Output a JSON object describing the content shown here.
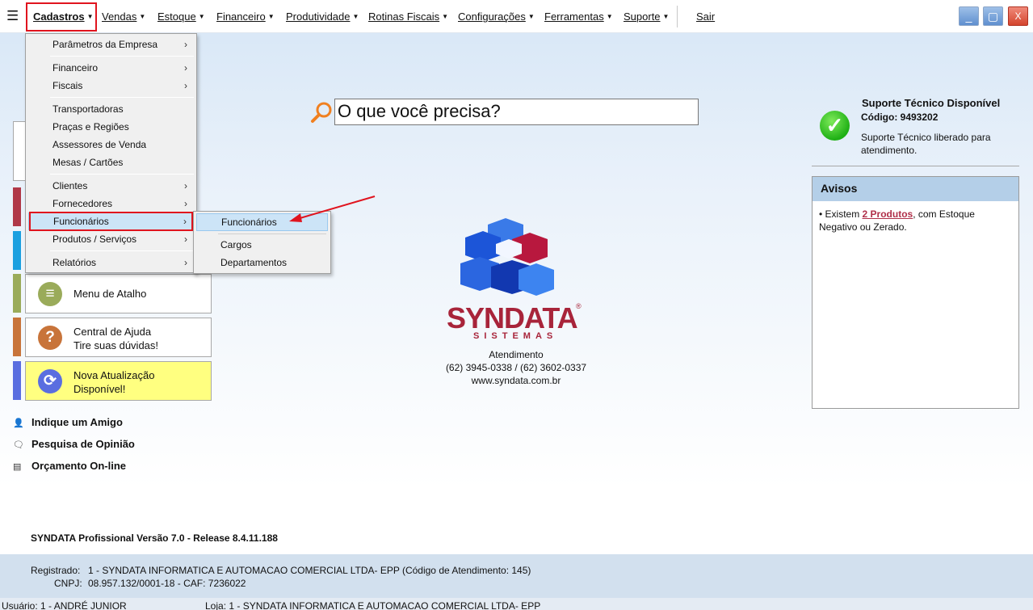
{
  "menubar": {
    "hamburger": "☰",
    "items": [
      "Cadastros",
      "Vendas",
      "Estoque",
      "Financeiro",
      "Produtividade",
      "Rotinas Fiscais",
      "Configurações",
      "Ferramentas",
      "Suporte"
    ],
    "exit": "Sair"
  },
  "window_controls": {
    "minimize": "_",
    "maximize": "▢",
    "close": "X"
  },
  "cadastros_menu": {
    "items": [
      {
        "label": "Parâmetros da Empresa",
        "submenu": true
      },
      {
        "label": "Financeiro",
        "submenu": true
      },
      {
        "label": "Fiscais",
        "submenu": true
      },
      {
        "label": "Transportadoras",
        "submenu": false
      },
      {
        "label": "Praças e Regiões",
        "submenu": false
      },
      {
        "label": "Assessores de Venda",
        "submenu": false
      },
      {
        "label": "Mesas / Cartões",
        "submenu": false
      },
      {
        "label": "Clientes",
        "submenu": true
      },
      {
        "label": "Fornecedores",
        "submenu": true
      },
      {
        "label": "Funcionários",
        "submenu": true,
        "active": true
      },
      {
        "label": "Produtos / Serviços",
        "submenu": true
      },
      {
        "label": "Relatórios",
        "submenu": true
      }
    ]
  },
  "funcionarios_submenu": {
    "items": [
      "Funcionários",
      "Cargos",
      "Departamentos"
    ]
  },
  "search": {
    "placeholder": "O que você precisa?"
  },
  "side_cards": [
    {
      "label": "Menu de Atalho",
      "color": "#9aab5a",
      "icon": "list-icon"
    },
    {
      "label_line1": "Central de Ajuda",
      "label_line2": "Tire suas dúvidas!",
      "color": "#c8743a",
      "icon": "question-icon"
    },
    {
      "label_line1": "Nova Atualização",
      "label_line2": "Disponível!",
      "color": "#5a6ee0",
      "icon": "refresh-icon"
    }
  ],
  "side_links": [
    "Indique um Amigo",
    "Pesquisa de Opinião",
    "Orçamento On-line"
  ],
  "logo": {
    "brand": "SYNDATA",
    "sub": "SISTEMAS",
    "reg": "®"
  },
  "contact": {
    "title": "Atendimento",
    "phones": "(62) 3945-0338 / (62) 3602-0337",
    "site": "www.syndata.com.br"
  },
  "support": {
    "title": "Suporte Técnico Disponível",
    "code_label": "Código: 9493202",
    "description": "Suporte Técnico liberado para atendimento."
  },
  "avisos": {
    "title": "Avisos",
    "text_before": "• Existem ",
    "link": "2 Produtos",
    "text_after": ", com Estoque Negativo ou Zerado."
  },
  "version": "SYNDATA Profissional Versão 7.0 - Release 8.4.11.188",
  "footer": {
    "registrado_label": "Registrado:",
    "registrado_value": "1 - SYNDATA INFORMATICA E AUTOMACAO COMERCIAL LTDA- EPP (Código de Atendimento: 145)",
    "cnpj_label": "CNPJ:",
    "cnpj_value": "08.957.132/0001-18 - CAF: 7236022"
  },
  "statusbar": {
    "usuario": "Usuário: 1 - ANDRÉ JUNIOR",
    "loja": "Loja: 1 - SYNDATA INFORMATICA E AUTOMACAO COMERCIAL LTDA- EPP"
  },
  "colors": {
    "highlight_box": "#e0141e",
    "menu_active": "#cce4f7",
    "avisos_header": "#b4cfe8"
  }
}
